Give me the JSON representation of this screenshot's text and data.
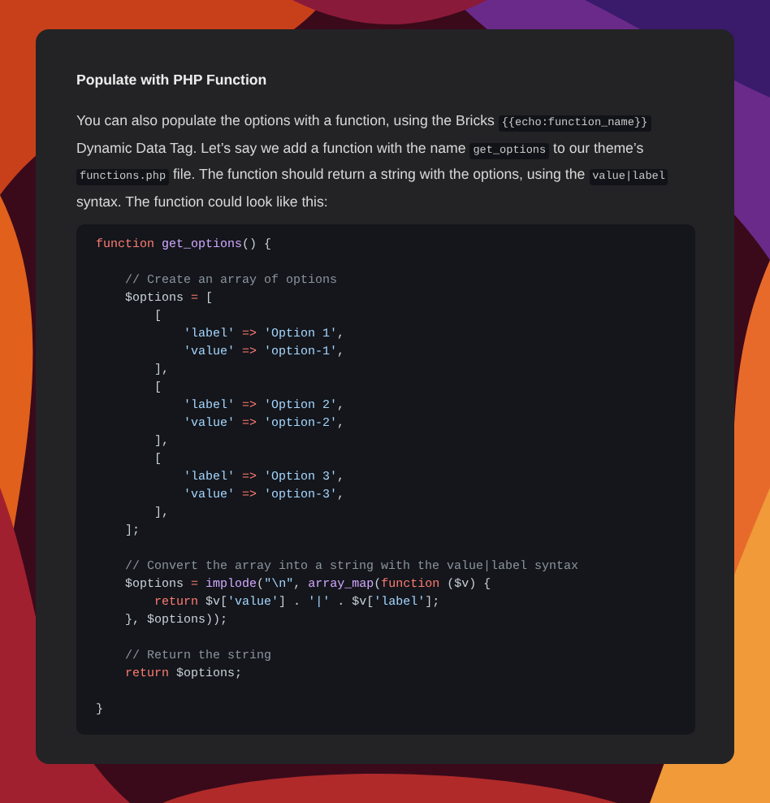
{
  "heading": "Populate with PHP Function",
  "paragraph": [
    {
      "kind": "text",
      "text": "You can also populate the options with a function, using the Bricks "
    },
    {
      "kind": "code",
      "text": "{{echo:function_name}}"
    },
    {
      "kind": "text",
      "text": " Dynamic Data Tag. Let’s say we add a function with the name "
    },
    {
      "kind": "code",
      "text": "get_options"
    },
    {
      "kind": "text",
      "text": " to our theme’s "
    },
    {
      "kind": "code",
      "text": "functions.php"
    },
    {
      "kind": "text",
      "text": " file. The function should return a string with the options, using the "
    },
    {
      "kind": "code",
      "text": "value|label"
    },
    {
      "kind": "text",
      "text": " syntax. The function could look like this:"
    }
  ],
  "code_lines": [
    {
      "tokens": [
        {
          "kind": "keyword",
          "text": "function"
        },
        {
          "kind": "name",
          "text": " get_options"
        },
        {
          "kind": "plain",
          "text": "() {"
        }
      ]
    },
    {
      "blank_before": true,
      "tokens": [
        {
          "kind": "comment",
          "text": "    // Create an array of options"
        }
      ]
    },
    {
      "tokens": [
        {
          "kind": "plain",
          "text": "    $options "
        },
        {
          "kind": "operator",
          "text": "="
        },
        {
          "kind": "plain",
          "text": " ["
        }
      ]
    },
    {
      "tokens": [
        {
          "kind": "plain",
          "text": "        ["
        }
      ]
    },
    {
      "tokens": [
        {
          "kind": "string",
          "text": "            'label' "
        },
        {
          "kind": "operator",
          "text": "=>"
        },
        {
          "kind": "string",
          "text": " 'Option 1'"
        },
        {
          "kind": "plain",
          "text": ","
        }
      ]
    },
    {
      "tokens": [
        {
          "kind": "string",
          "text": "            'value' "
        },
        {
          "kind": "operator",
          "text": "=>"
        },
        {
          "kind": "string",
          "text": " 'option-1'"
        },
        {
          "kind": "plain",
          "text": ","
        }
      ]
    },
    {
      "tokens": [
        {
          "kind": "plain",
          "text": "        ],"
        }
      ]
    },
    {
      "tokens": [
        {
          "kind": "plain",
          "text": "        ["
        }
      ]
    },
    {
      "tokens": [
        {
          "kind": "string",
          "text": "            'label' "
        },
        {
          "kind": "operator",
          "text": "=>"
        },
        {
          "kind": "string",
          "text": " 'Option 2'"
        },
        {
          "kind": "plain",
          "text": ","
        }
      ]
    },
    {
      "tokens": [
        {
          "kind": "string",
          "text": "            'value' "
        },
        {
          "kind": "operator",
          "text": "=>"
        },
        {
          "kind": "string",
          "text": " 'option-2'"
        },
        {
          "kind": "plain",
          "text": ","
        }
      ]
    },
    {
      "tokens": [
        {
          "kind": "plain",
          "text": "        ],"
        }
      ]
    },
    {
      "tokens": [
        {
          "kind": "plain",
          "text": "        ["
        }
      ]
    },
    {
      "tokens": [
        {
          "kind": "string",
          "text": "            'label' "
        },
        {
          "kind": "operator",
          "text": "=>"
        },
        {
          "kind": "string",
          "text": " 'Option 3'"
        },
        {
          "kind": "plain",
          "text": ","
        }
      ]
    },
    {
      "tokens": [
        {
          "kind": "string",
          "text": "            'value' "
        },
        {
          "kind": "operator",
          "text": "=>"
        },
        {
          "kind": "string",
          "text": " 'option-3'"
        },
        {
          "kind": "plain",
          "text": ","
        }
      ]
    },
    {
      "tokens": [
        {
          "kind": "plain",
          "text": "        ],"
        }
      ]
    },
    {
      "tokens": [
        {
          "kind": "plain",
          "text": "    ];"
        }
      ]
    },
    {
      "blank_before": true,
      "tokens": [
        {
          "kind": "comment",
          "text": "    // Convert the array into a string with the value|label syntax"
        }
      ]
    },
    {
      "tokens": [
        {
          "kind": "plain",
          "text": "    $options "
        },
        {
          "kind": "operator",
          "text": "="
        },
        {
          "kind": "name",
          "text": " implode"
        },
        {
          "kind": "plain",
          "text": "("
        },
        {
          "kind": "string",
          "text": "\"\\n\""
        },
        {
          "kind": "plain",
          "text": ", "
        },
        {
          "kind": "name",
          "text": "array_map"
        },
        {
          "kind": "plain",
          "text": "("
        },
        {
          "kind": "keyword",
          "text": "function"
        },
        {
          "kind": "plain",
          "text": " ($v) {"
        }
      ]
    },
    {
      "tokens": [
        {
          "kind": "keyword",
          "text": "        return"
        },
        {
          "kind": "plain",
          "text": " $v["
        },
        {
          "kind": "string",
          "text": "'value'"
        },
        {
          "kind": "plain",
          "text": "] . "
        },
        {
          "kind": "string",
          "text": "'|'"
        },
        {
          "kind": "plain",
          "text": " . $v["
        },
        {
          "kind": "string",
          "text": "'label'"
        },
        {
          "kind": "plain",
          "text": "];"
        }
      ]
    },
    {
      "tokens": [
        {
          "kind": "plain",
          "text": "    }, $options));"
        }
      ]
    },
    {
      "blank_before": true,
      "tokens": [
        {
          "kind": "comment",
          "text": "    // Return the string"
        }
      ]
    },
    {
      "tokens": [
        {
          "kind": "keyword",
          "text": "    return"
        },
        {
          "kind": "plain",
          "text": " $options;"
        }
      ]
    },
    {
      "blank_before": true,
      "tokens": [
        {
          "kind": "plain",
          "text": "}"
        }
      ]
    }
  ]
}
